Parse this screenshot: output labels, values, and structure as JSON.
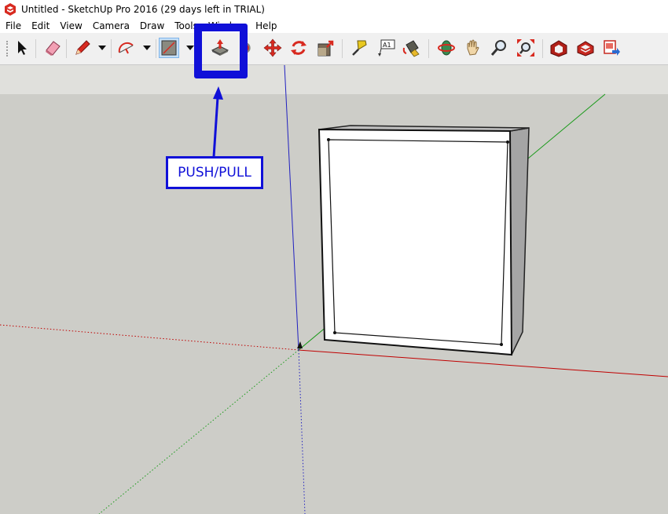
{
  "window": {
    "title": "Untitled - SketchUp Pro 2016 (29 days left in TRIAL)"
  },
  "menubar": {
    "items": [
      {
        "id": "file",
        "label": "File"
      },
      {
        "id": "edit",
        "label": "Edit"
      },
      {
        "id": "view",
        "label": "View"
      },
      {
        "id": "camera",
        "label": "Camera"
      },
      {
        "id": "draw",
        "label": "Draw"
      },
      {
        "id": "tools",
        "label": "Tools"
      },
      {
        "id": "window",
        "label": "Window"
      },
      {
        "id": "help",
        "label": "Help"
      }
    ]
  },
  "toolbar": {
    "tools": [
      {
        "id": "select",
        "icon": "select-arrow-icon"
      },
      {
        "id": "eraser",
        "icon": "eraser-icon"
      },
      {
        "id": "pencil",
        "icon": "pencil-icon"
      },
      {
        "id": "arc",
        "icon": "arc-icon"
      },
      {
        "id": "rectangle",
        "icon": "rectangle-icon",
        "active": true
      },
      {
        "id": "push-pull",
        "icon": "push-pull-icon"
      },
      {
        "id": "offset",
        "icon": "offset-icon"
      },
      {
        "id": "move",
        "icon": "move-icon"
      },
      {
        "id": "rotate",
        "icon": "rotate-icon"
      },
      {
        "id": "scale",
        "icon": "scale-icon"
      },
      {
        "id": "tape-measure",
        "icon": "tape-measure-icon"
      },
      {
        "id": "text",
        "icon": "text-label-icon",
        "text": "A1"
      },
      {
        "id": "paint-bucket",
        "icon": "paint-bucket-icon"
      },
      {
        "id": "orbit",
        "icon": "orbit-icon"
      },
      {
        "id": "pan",
        "icon": "pan-hand-icon"
      },
      {
        "id": "zoom",
        "icon": "zoom-icon"
      },
      {
        "id": "zoom-extents",
        "icon": "zoom-extents-icon"
      },
      {
        "id": "3d-warehouse",
        "icon": "warehouse-icon"
      },
      {
        "id": "extension-warehouse",
        "icon": "extension-warehouse-icon"
      },
      {
        "id": "send-to-layout",
        "icon": "send-to-layout-icon"
      }
    ]
  },
  "annotation": {
    "label": "PUSH/PULL",
    "color": "#1010d8"
  },
  "colors": {
    "viewport": "#cdcdc8",
    "red_axis": "#c00000",
    "green_axis": "#1a9a1a",
    "blue_axis": "#2020c0",
    "highlight": "#1010d8",
    "active_tool": "#c6e0f7"
  }
}
